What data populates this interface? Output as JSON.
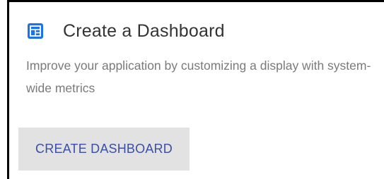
{
  "card": {
    "icon": "dashboard-grid-icon",
    "title": "Create a Dashboard",
    "description": "Improve your application by customizing a display with system-wide metrics",
    "button_label": "CREATE DASHBOARD"
  },
  "colors": {
    "icon": "#1a73e8",
    "title": "#333333",
    "description": "#7a7a7a",
    "button_bg": "#e2e2e2",
    "button_text": "#3a4fa5"
  }
}
